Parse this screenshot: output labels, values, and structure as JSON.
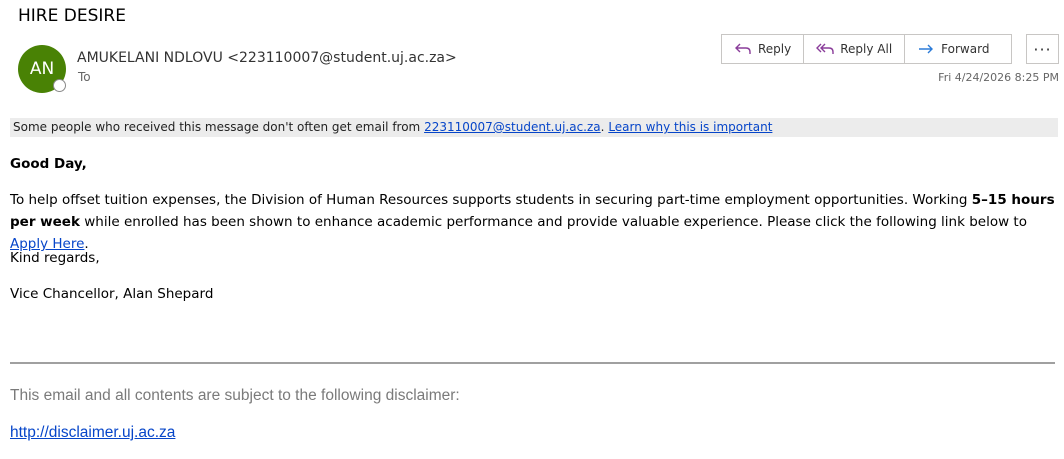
{
  "email": {
    "subject": "HIRE DESIRE",
    "avatar_initials": "AN",
    "sender": "AMUKELANI NDLOVU <223110007@student.uj.ac.za>",
    "to_label": "To",
    "datetime": "Fri 4/24/2026 8:25 PM"
  },
  "actions": {
    "reply": "Reply",
    "reply_all": "Reply All",
    "forward": "Forward",
    "more": "···"
  },
  "banner": {
    "text": "Some people who received this message don't often get email from",
    "email_link": "223110007@student.uj.ac.za",
    "separator": ".",
    "learn_link": "Learn why this is important"
  },
  "body": {
    "greeting": "Good Day,",
    "para_1": "To help offset tuition expenses, the Division of Human Resources supports students in securing part-time employment opportunities. Working",
    "para_bold": "5–15 hours per week",
    "para_2": "while enrolled has been shown to enhance academic performance and provide valuable experience. Please click the following link below to",
    "apply_link": "Apply Here",
    "para_end": ".",
    "closing": "Kind regards,",
    "signature": "Vice Chancellor, Alan Shepard"
  },
  "footer": {
    "disclaimer": "This email and all contents are subject to the following disclaimer:",
    "disclaimer_link": "http://disclaimer.uj.ac.za"
  },
  "colors": {
    "avatar": "#498205",
    "link": "#0645c9",
    "reply_icon": "#8a3d9a",
    "forward_icon": "#2b7bd8"
  }
}
